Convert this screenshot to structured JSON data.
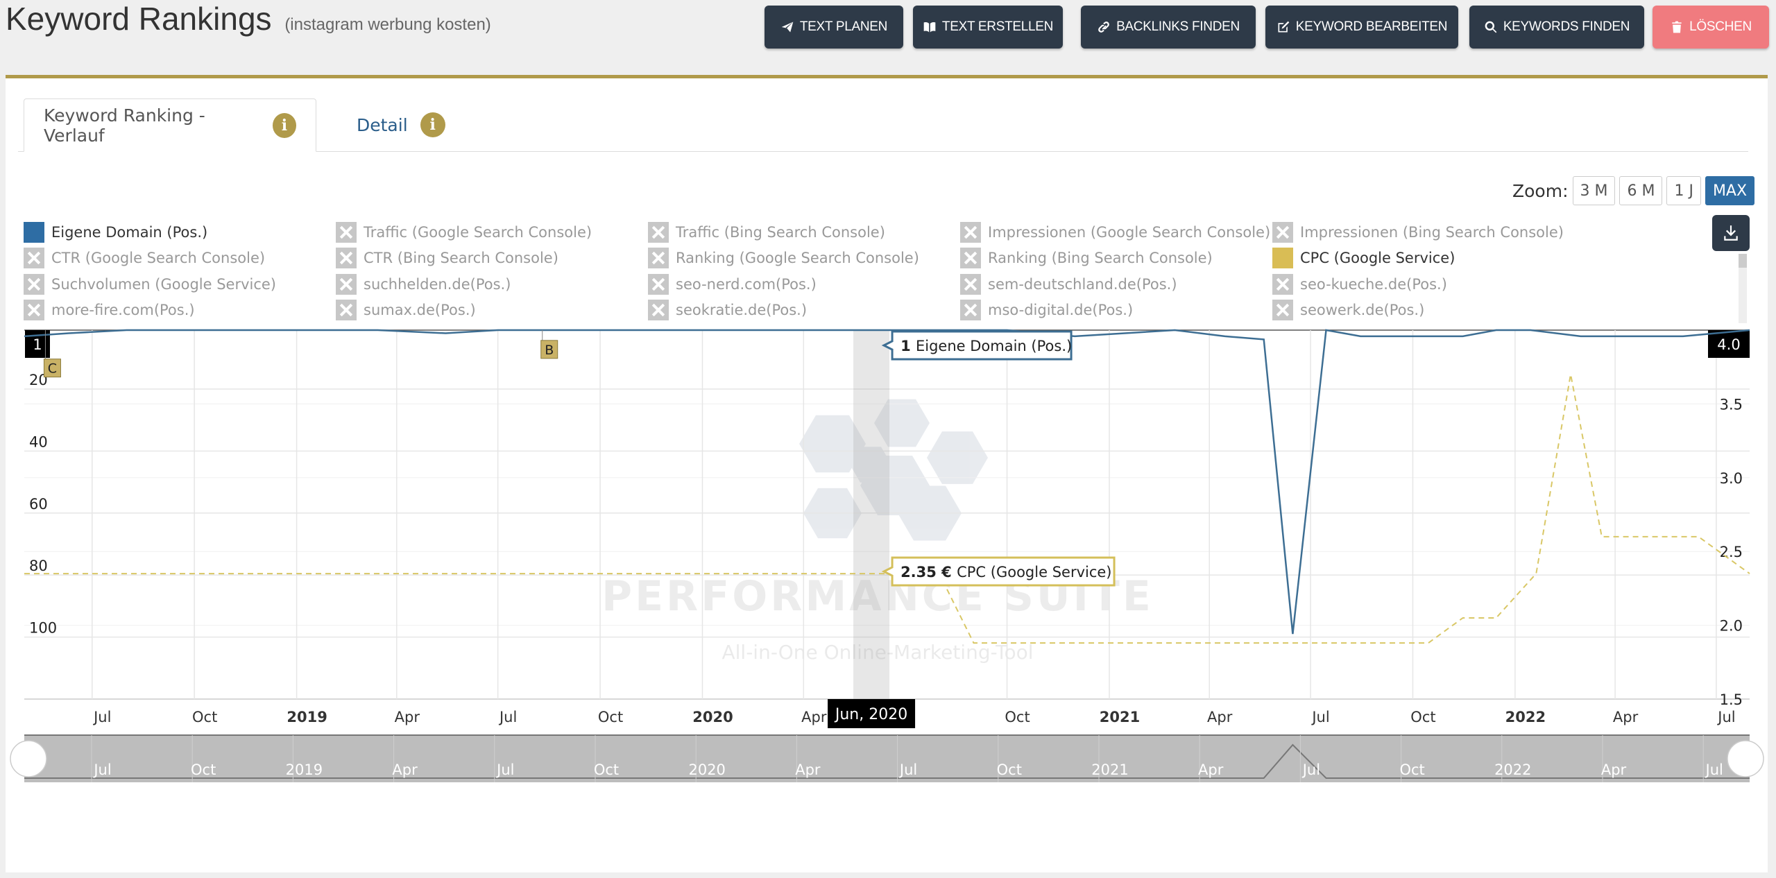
{
  "header": {
    "title": "Keyword Rankings",
    "subtitle": "(instagram werbung kosten)"
  },
  "toolbar": {
    "buttons": [
      {
        "label": "TEXT PLANEN",
        "icon": "paper-plane-icon"
      },
      {
        "label": "TEXT ERSTELLEN",
        "icon": "book-icon"
      },
      {
        "label": "BACKLINKS FINDEN",
        "icon": "link-icon"
      },
      {
        "label": "KEYWORD BEARBEITEN",
        "icon": "edit-icon"
      },
      {
        "label": "KEYWORDS FINDEN",
        "icon": "search-icon"
      },
      {
        "label": "LÖSCHEN",
        "icon": "trash-icon"
      }
    ]
  },
  "tabs": [
    {
      "label": "Keyword Ranking - Verlauf",
      "active": true
    },
    {
      "label": "Detail",
      "active": false
    }
  ],
  "zoom": {
    "label": "Zoom:",
    "options": [
      "3 M",
      "6 M",
      "1 J",
      "MAX"
    ],
    "selected": "MAX"
  },
  "legend": [
    {
      "label": "Eigene Domain (Pos.)",
      "enabled": true,
      "color": "#2e6da4"
    },
    {
      "label": "Traffic (Google Search Console)",
      "enabled": false
    },
    {
      "label": "Traffic (Bing Search Console)",
      "enabled": false
    },
    {
      "label": "Impressionen (Google Search Console)",
      "enabled": false
    },
    {
      "label": "Impressionen (Bing Search Console)",
      "enabled": false
    },
    {
      "label": "CTR (Google Search Console)",
      "enabled": false
    },
    {
      "label": "CTR (Bing Search Console)",
      "enabled": false
    },
    {
      "label": "Ranking (Google Search Console)",
      "enabled": false
    },
    {
      "label": "Ranking (Bing Search Console)",
      "enabled": false
    },
    {
      "label": "CPC (Google Service)",
      "enabled": true,
      "color": "#d9bd55"
    },
    {
      "label": "Suchvolumen (Google Service)",
      "enabled": false
    },
    {
      "label": "suchhelden.de(Pos.)",
      "enabled": false
    },
    {
      "label": "seo-nerd.com(Pos.)",
      "enabled": false
    },
    {
      "label": "sem-deutschland.de(Pos.)",
      "enabled": false
    },
    {
      "label": "seo-kueche.de(Pos.)",
      "enabled": false
    },
    {
      "label": "more-fire.com(Pos.)",
      "enabled": false
    },
    {
      "label": "sumax.de(Pos.)",
      "enabled": false
    },
    {
      "label": "seokratie.de(Pos.)",
      "enabled": false
    },
    {
      "label": "mso-digital.de(Pos.)",
      "enabled": false
    },
    {
      "label": "seowerk.de(Pos.)",
      "enabled": false
    }
  ],
  "watermark": {
    "title": "PERFORMANCE SUITE",
    "tagline": "All-in-One Online-Marketing-Tool"
  },
  "chart_data": {
    "type": "line",
    "x_axis": {
      "type": "datetime",
      "range": [
        "2018-05-01",
        "2022-07-31"
      ],
      "ticks": [
        {
          "date": "2018-07-01",
          "label": "Jul"
        },
        {
          "date": "2018-10-01",
          "label": "Oct"
        },
        {
          "date": "2019-01-01",
          "label": "2019",
          "bold": true
        },
        {
          "date": "2019-04-01",
          "label": "Apr"
        },
        {
          "date": "2019-07-01",
          "label": "Jul"
        },
        {
          "date": "2019-10-01",
          "label": "Oct"
        },
        {
          "date": "2020-01-01",
          "label": "2020",
          "bold": true
        },
        {
          "date": "2020-04-01",
          "label": "Apr"
        },
        {
          "date": "2020-10-01",
          "label": "Oct"
        },
        {
          "date": "2021-01-01",
          "label": "2021",
          "bold": true
        },
        {
          "date": "2021-04-01",
          "label": "Apr"
        },
        {
          "date": "2021-07-01",
          "label": "Jul"
        },
        {
          "date": "2021-10-01",
          "label": "Oct"
        },
        {
          "date": "2022-01-01",
          "label": "2022",
          "bold": true
        },
        {
          "date": "2022-04-01",
          "label": "Apr"
        },
        {
          "date": "2022-07-01",
          "label": "Jul"
        }
      ],
      "crosshair_date": "2020-06-01",
      "crosshair_label": "Jun, 2020"
    },
    "y_left": {
      "reversed": true,
      "range": [
        1,
        120
      ],
      "ticks": [
        20,
        40,
        60,
        80,
        100
      ],
      "end_label": "1"
    },
    "y_right": {
      "range": [
        1.5,
        4.0
      ],
      "ticks": [
        1.5,
        2.0,
        2.5,
        3.0,
        3.5
      ],
      "end_label": "4.0"
    },
    "series": [
      {
        "name": "Eigene Domain (Pos.)",
        "axis": "left",
        "color": "#3d6e93",
        "dash": false,
        "points": [
          [
            "2018-05-01",
            3
          ],
          [
            "2018-06-10",
            2
          ],
          [
            "2018-08-01",
            1
          ],
          [
            "2018-10-01",
            1
          ],
          [
            "2019-01-01",
            1
          ],
          [
            "2019-03-15",
            1
          ],
          [
            "2019-05-15",
            2
          ],
          [
            "2019-07-01",
            1
          ],
          [
            "2019-09-01",
            1
          ],
          [
            "2019-11-01",
            1
          ],
          [
            "2020-01-01",
            1
          ],
          [
            "2020-03-01",
            1
          ],
          [
            "2020-06-01",
            1
          ],
          [
            "2020-08-01",
            1
          ],
          [
            "2020-10-01",
            1
          ],
          [
            "2020-12-01",
            3
          ],
          [
            "2021-01-15",
            2
          ],
          [
            "2021-03-01",
            1
          ],
          [
            "2021-04-15",
            3
          ],
          [
            "2021-05-20",
            4
          ],
          [
            "2021-06-15",
            99
          ],
          [
            "2021-07-15",
            1
          ],
          [
            "2021-08-15",
            3
          ],
          [
            "2021-10-01",
            3
          ],
          [
            "2021-11-15",
            3
          ],
          [
            "2021-12-15",
            1
          ],
          [
            "2022-01-15",
            1
          ],
          [
            "2022-03-01",
            3
          ],
          [
            "2022-04-15",
            3
          ],
          [
            "2022-06-01",
            3
          ],
          [
            "2022-07-31",
            1
          ]
        ]
      },
      {
        "name": "CPC (Google Service)",
        "axis": "right",
        "color": "#d9c766",
        "dash": true,
        "points": [
          [
            "2018-05-01",
            2.35
          ],
          [
            "2018-07-01",
            2.35
          ],
          [
            "2019-01-01",
            2.35
          ],
          [
            "2019-07-01",
            2.35
          ],
          [
            "2020-01-01",
            2.35
          ],
          [
            "2020-06-01",
            2.35
          ],
          [
            "2020-08-01",
            2.35
          ],
          [
            "2020-09-01",
            1.88
          ],
          [
            "2021-01-01",
            1.88
          ],
          [
            "2021-06-01",
            1.88
          ],
          [
            "2021-10-15",
            1.88
          ],
          [
            "2021-11-15",
            2.05
          ],
          [
            "2021-12-15",
            2.05
          ],
          [
            "2022-01-20",
            2.35
          ],
          [
            "2022-02-20",
            3.7
          ],
          [
            "2022-03-20",
            2.6
          ],
          [
            "2022-04-15",
            2.6
          ],
          [
            "2022-06-15",
            2.6
          ],
          [
            "2022-07-31",
            2.35
          ]
        ]
      }
    ],
    "flags": [
      {
        "date": "2018-05-20",
        "label": "C",
        "value": 13
      },
      {
        "date": "2019-08-10",
        "label": "B",
        "value": 7
      }
    ],
    "tooltips": [
      {
        "series": "Eigene Domain (Pos.)",
        "value_text": "1",
        "label": "Eigene Domain (Pos.)"
      },
      {
        "series": "CPC (Google Service)",
        "value_text": "2.35 €",
        "label": "CPC (Google Service)"
      }
    ],
    "navigator": {
      "ticks": [
        "Jul",
        "Oct",
        "2019",
        "Apr",
        "Jul",
        "Oct",
        "2020",
        "Apr",
        "Jul",
        "Oct",
        "2021",
        "Apr",
        "Jul",
        "Oct",
        "2022",
        "Apr",
        "Jul"
      ]
    }
  }
}
